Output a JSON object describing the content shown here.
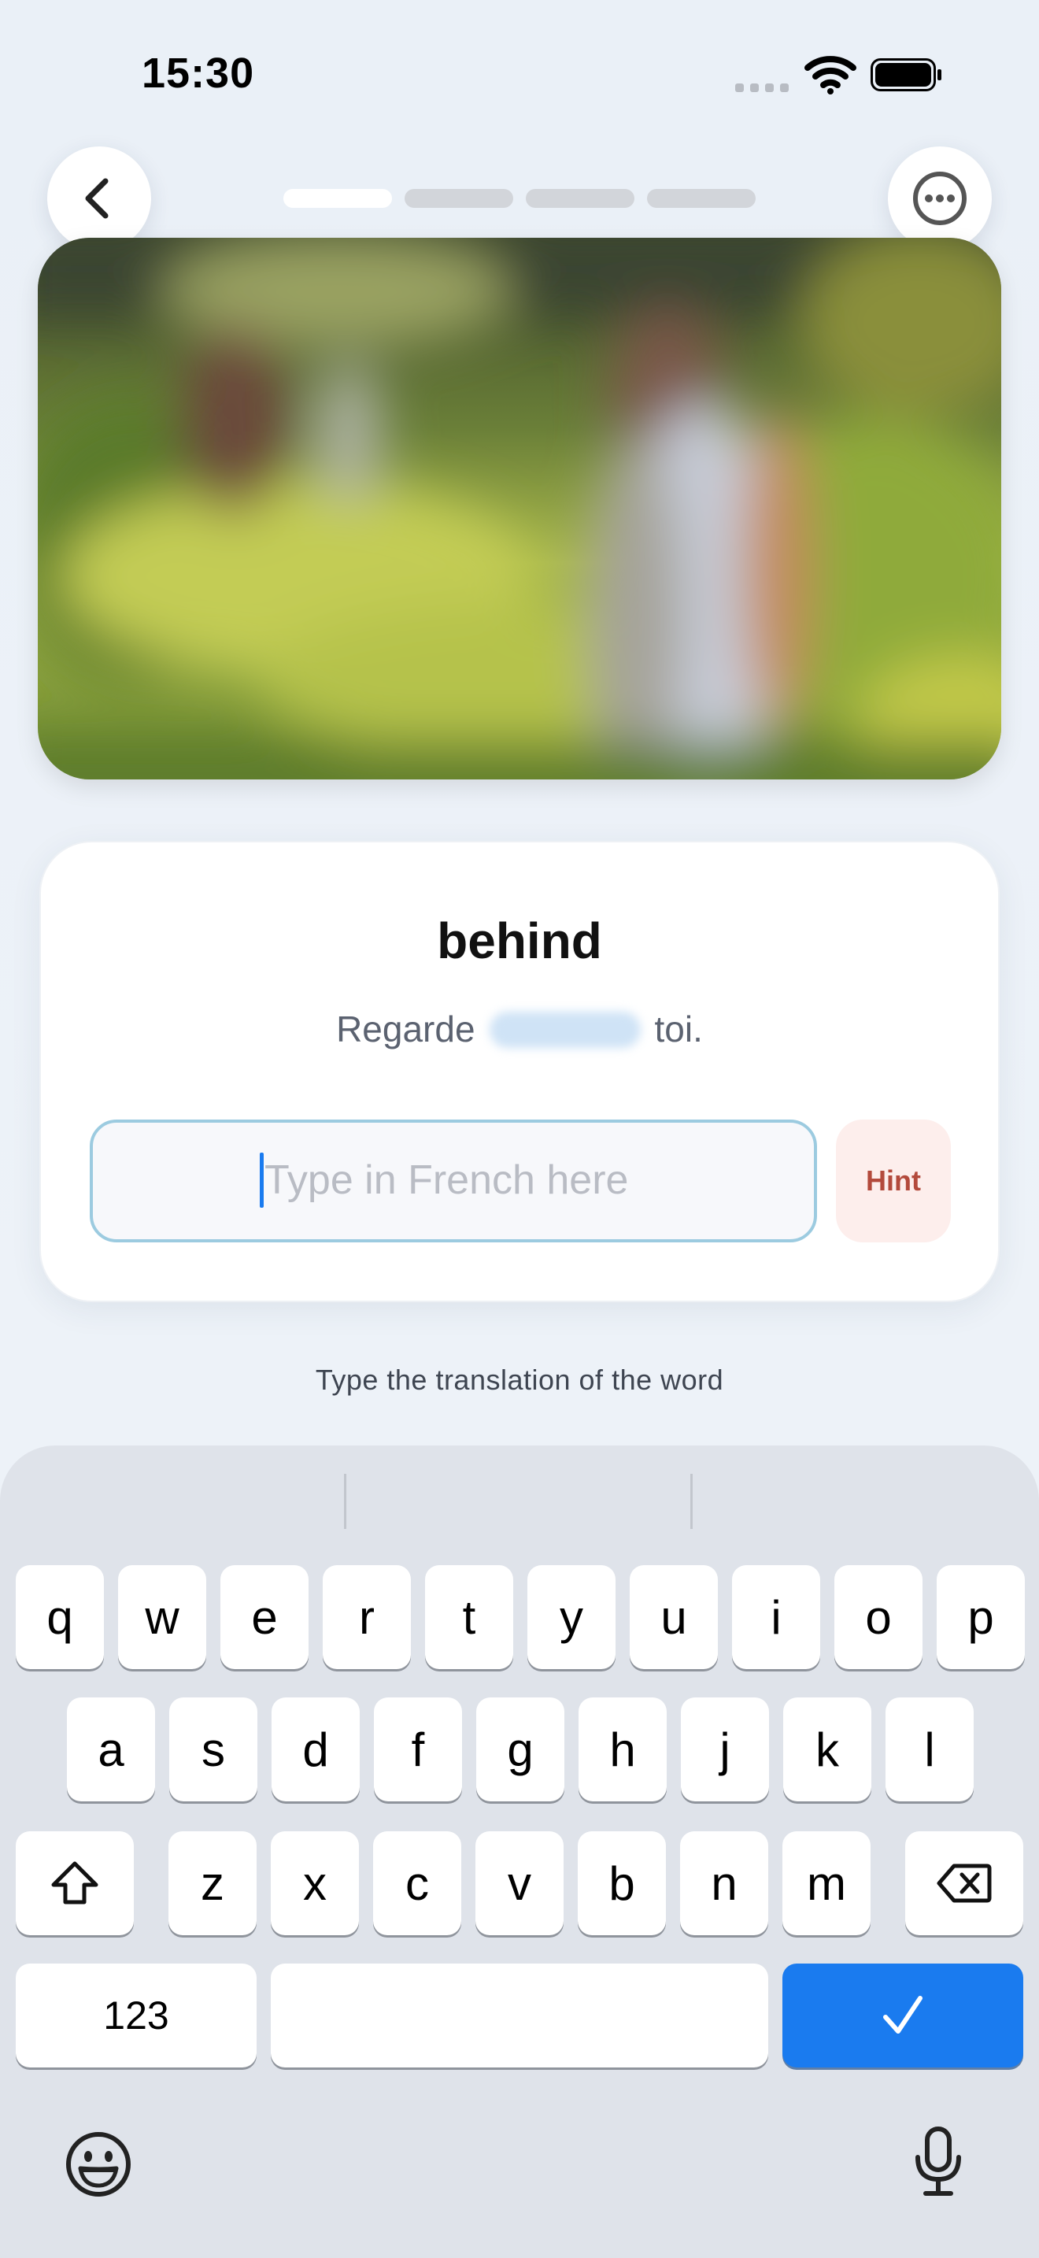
{
  "status_bar": {
    "time": "15:30"
  },
  "lesson": {
    "progress": {
      "total_steps": 4,
      "current_step": 1
    },
    "word": "behind",
    "sentence": {
      "before": "Regarde",
      "after": "toi."
    },
    "answer_placeholder": "Type in French here",
    "hint_label": "Hint",
    "instruction": "Type the translation of the word"
  },
  "keyboard": {
    "row1": [
      "q",
      "w",
      "e",
      "r",
      "t",
      "y",
      "u",
      "i",
      "o",
      "p"
    ],
    "row2": [
      "a",
      "s",
      "d",
      "f",
      "g",
      "h",
      "j",
      "k",
      "l"
    ],
    "row3": [
      "z",
      "x",
      "c",
      "v",
      "b",
      "n",
      "m"
    ],
    "numbers_label": "123"
  },
  "icons": {
    "back": "chevron-left-icon",
    "more": "ellipsis-circle-icon",
    "shift": "shift-icon",
    "delete": "backspace-icon",
    "done": "checkmark-icon",
    "emoji": "emoji-icon",
    "mic": "microphone-icon"
  },
  "colors": {
    "accent": "#1a7bef",
    "hint_text": "#b34a3c",
    "hint_bg": "#fdeeec"
  }
}
